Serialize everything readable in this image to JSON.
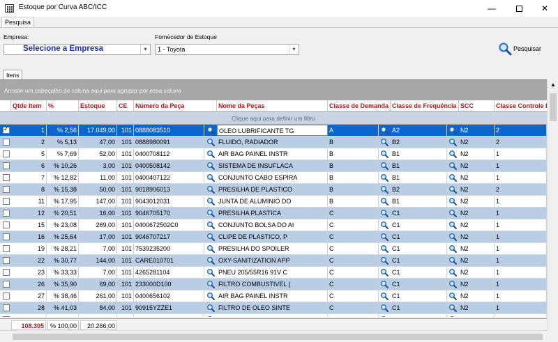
{
  "window": {
    "title": "Estoque por Curva ABC/ICC",
    "minimize": "—",
    "close": "✕"
  },
  "top_tab": "Pesquisa",
  "search": {
    "empresa_label": "Empresa:",
    "empresa_value": "Selecione a Empresa",
    "fornecedor_label": "Fornecedor de Estoque",
    "fornecedor_value": "1 - Toyota",
    "button_label": "Pesquisar"
  },
  "items_tab": "Itens",
  "grid": {
    "group_panel_text": "Arraste um cabeçalho de coluna aqui para agrupar por essa coluna",
    "filter_text": "Clique aqui para definir um filtro",
    "columns": [
      "Qtde Item",
      "%",
      "Estoque",
      "CE",
      "Número da Peça",
      "Nome da Peças",
      "Classe de Demanda",
      "Classe de Frequência",
      "SCC",
      "Classe Controle Estoque"
    ],
    "rows": [
      {
        "checked": true,
        "qtde": "1",
        "pct": "% 2,56",
        "estoque": "17.049,00",
        "ce": "101",
        "numero": "0888083510",
        "nome": "OLEO LUBRIFICANTE TG",
        "demanda": "A",
        "frequencia": "A2",
        "scc": "N2",
        "controle": "2"
      },
      {
        "checked": false,
        "qtde": "2",
        "pct": "% 5,13",
        "estoque": "47,00",
        "ce": "101",
        "numero": "0888980091",
        "nome": "FLUIDO, RADIADOR",
        "demanda": "B",
        "frequencia": "B2",
        "scc": "N2",
        "controle": "2"
      },
      {
        "checked": false,
        "qtde": "5",
        "pct": "% 7,69",
        "estoque": "52,00",
        "ce": "101",
        "numero": "0400708112",
        "nome": "AIR BAG PAINEL INSTR",
        "demanda": "B",
        "frequencia": "B1",
        "scc": "N2",
        "controle": "1"
      },
      {
        "checked": false,
        "qtde": "6",
        "pct": "% 10,26",
        "estoque": "3,00",
        "ce": "101",
        "numero": "0400508142",
        "nome": "SISTEMA DE INSUFLACA",
        "demanda": "B",
        "frequencia": "B1",
        "scc": "N2",
        "controle": "1"
      },
      {
        "checked": false,
        "qtde": "7",
        "pct": "% 12,82",
        "estoque": "11,00",
        "ce": "101",
        "numero": "0400407122",
        "nome": "CONJUNTO CABO ESPIRA",
        "demanda": "B",
        "frequencia": "B1",
        "scc": "N2",
        "controle": "1"
      },
      {
        "checked": false,
        "qtde": "8",
        "pct": "% 15,38",
        "estoque": "50,00",
        "ce": "101",
        "numero": "9018906013",
        "nome": "PRESILHA DE PLASTICO",
        "demanda": "B",
        "frequencia": "B2",
        "scc": "N2",
        "controle": "2"
      },
      {
        "checked": false,
        "qtde": "11",
        "pct": "% 17,95",
        "estoque": "147,00",
        "ce": "101",
        "numero": "9043012031",
        "nome": "JUNTA DE ALUMINIO DO",
        "demanda": "B",
        "frequencia": "B1",
        "scc": "N2",
        "controle": "1"
      },
      {
        "checked": false,
        "qtde": "12",
        "pct": "% 20,51",
        "estoque": "16,00",
        "ce": "101",
        "numero": "9046705170",
        "nome": "PRESILHA PLASTICA",
        "demanda": "C",
        "frequencia": "C1",
        "scc": "N2",
        "controle": "1"
      },
      {
        "checked": false,
        "qtde": "15",
        "pct": "% 23,08",
        "estoque": "269,00",
        "ce": "101",
        "numero": "0400672502C0",
        "nome": "CONJUNTO BOLSA DO AI",
        "demanda": "C",
        "frequencia": "C1",
        "scc": "N2",
        "controle": "1"
      },
      {
        "checked": false,
        "qtde": "16",
        "pct": "% 25,64",
        "estoque": "17,00",
        "ce": "101",
        "numero": "9046707217",
        "nome": "CLIPE DE PLASTICO, P",
        "demanda": "C",
        "frequencia": "C1",
        "scc": "N2",
        "controle": "1"
      },
      {
        "checked": false,
        "qtde": "19",
        "pct": "% 28,21",
        "estoque": "7,00",
        "ce": "101",
        "numero": "7539235200",
        "nome": "PRESILHA DO SPOILER",
        "demanda": "C",
        "frequencia": "C1",
        "scc": "N2",
        "controle": "1"
      },
      {
        "checked": false,
        "qtde": "22",
        "pct": "% 30,77",
        "estoque": "144,00",
        "ce": "101",
        "numero": "CARE010701",
        "nome": "OXY-SANITIZATION APP",
        "demanda": "C",
        "frequencia": "C1",
        "scc": "N2",
        "controle": "1"
      },
      {
        "checked": false,
        "qtde": "23",
        "pct": "% 33,33",
        "estoque": "7,00",
        "ce": "101",
        "numero": "4265281104",
        "nome": "PNEU 205/55R16 91V C",
        "demanda": "C",
        "frequencia": "C1",
        "scc": "N2",
        "controle": "1"
      },
      {
        "checked": false,
        "qtde": "26",
        "pct": "% 35,90",
        "estoque": "69,00",
        "ce": "101",
        "numero": "233000D100",
        "nome": "FILTRO COMBUSTIVEL (",
        "demanda": "C",
        "frequencia": "C1",
        "scc": "N2",
        "controle": "1"
      },
      {
        "checked": false,
        "qtde": "27",
        "pct": "% 38,46",
        "estoque": "261,00",
        "ce": "101",
        "numero": "0400656102",
        "nome": "AIR BAG PAINEL INSTR",
        "demanda": "C",
        "frequencia": "C1",
        "scc": "N2",
        "controle": "1"
      },
      {
        "checked": false,
        "qtde": "28",
        "pct": "% 41,03",
        "estoque": "84,00",
        "ce": "101",
        "numero": "90915YZZE1",
        "nome": "FILTRO DE OLEO SINTE",
        "demanda": "C",
        "frequencia": "C1",
        "scc": "N2",
        "controle": "1"
      },
      {
        "checked": false,
        "qtde": "29",
        "pct": "% 43,59",
        "estoque": "1,00",
        "ce": "101",
        "numero": "9052013002",
        "nome": "ANEL TRAVA (PLASTICO",
        "demanda": "C",
        "frequencia": "C1",
        "scc": "N2",
        "controle": "1"
      }
    ],
    "footer": {
      "total_qtde": "108.305",
      "total_pct": "% 100,00",
      "total_estoque": "20.266,00"
    }
  }
}
